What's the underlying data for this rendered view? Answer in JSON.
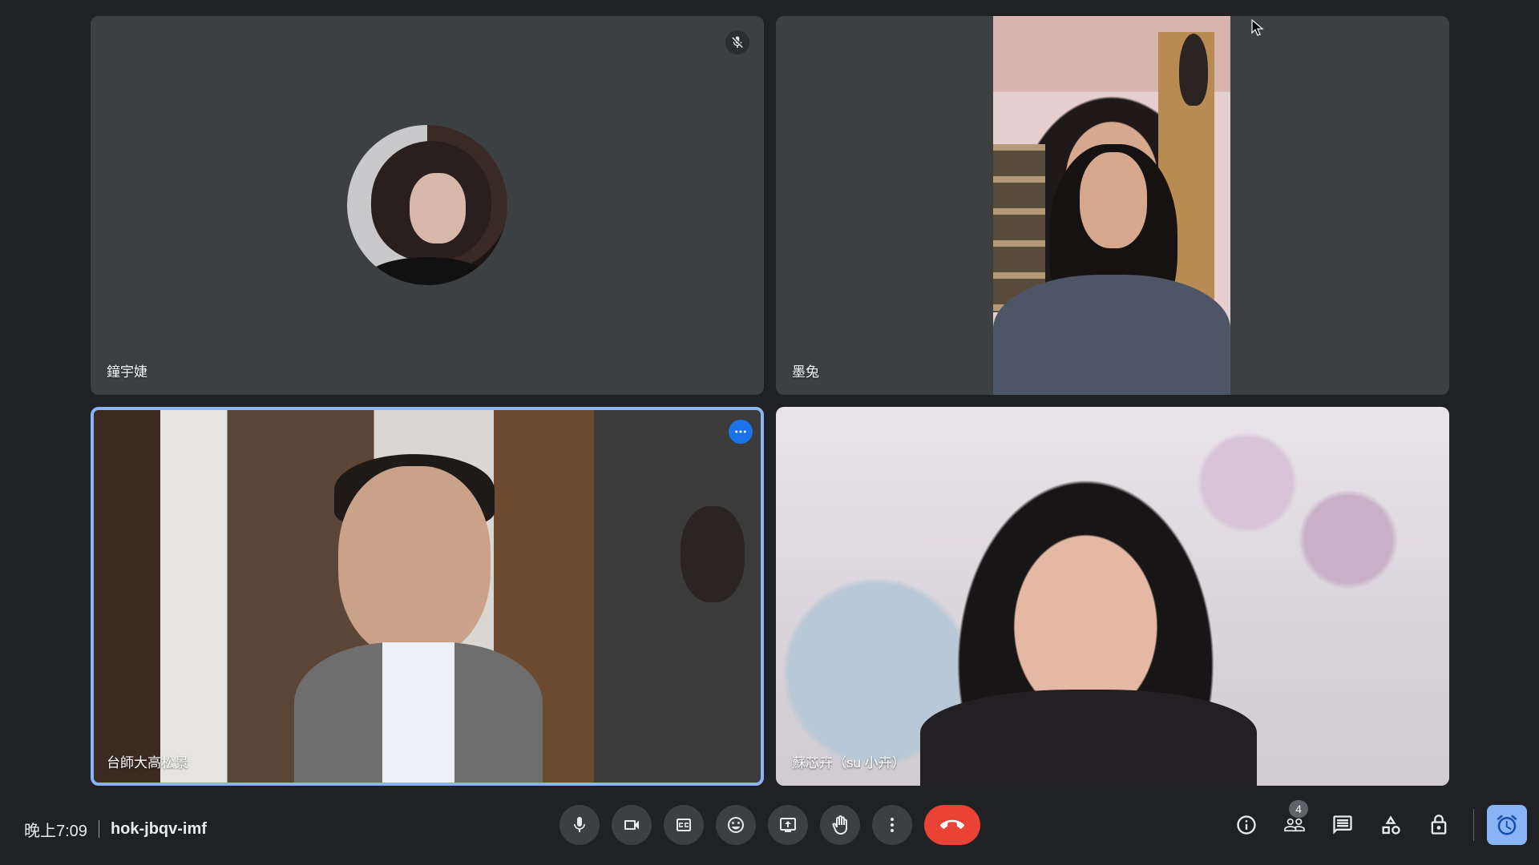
{
  "participants": [
    {
      "name": "鐘宇婕"
    },
    {
      "name": "墨兔"
    },
    {
      "name": "台師大高松景"
    },
    {
      "name": "蘇芯卉（su 小卉）"
    }
  ],
  "bottom_bar": {
    "time": "晚上7:09",
    "meeting_code": "hok-jbqv-imf",
    "people_count": "4"
  },
  "controls": [
    "mic-icon",
    "camera-icon",
    "captions-icon",
    "emoji-icon",
    "present-icon",
    "raise-hand-icon",
    "more-options-icon",
    "end-call-icon"
  ],
  "right_tools": [
    "info-icon",
    "people-icon",
    "chat-icon",
    "activities-icon",
    "host-controls-icon",
    "timer-icon"
  ],
  "colors": {
    "background": "#202124",
    "tile": "#3c4043",
    "active_border": "#8ab4f8",
    "end_call": "#ea4335",
    "accent_blue": "#1a73e8"
  }
}
